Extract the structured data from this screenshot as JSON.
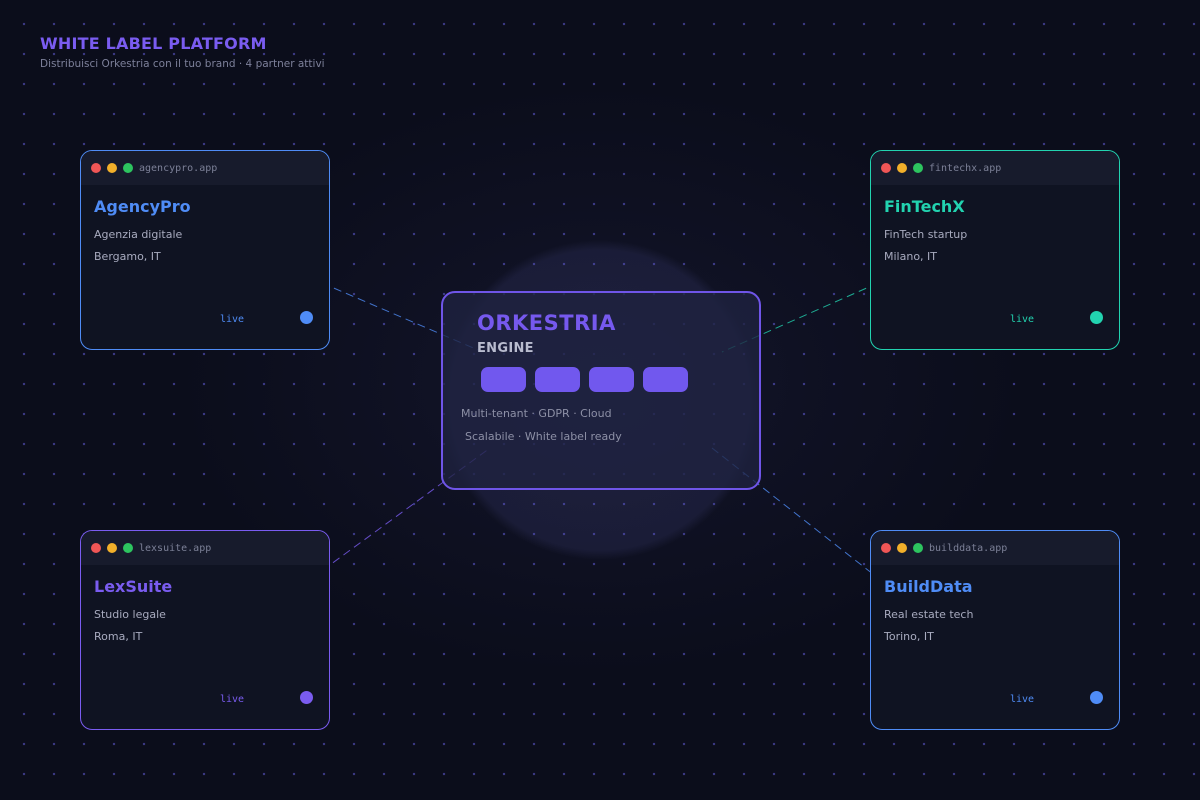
{
  "header": {
    "title": "WHITE LABEL PLATFORM",
    "subtitle": "Distribuisci Orkestria con il tuo brand · 4 partner attivi"
  },
  "engine": {
    "title": "ORKESTRIA",
    "subtitle": "ENGINE",
    "features_line1": "Multi-tenant · GDPR · Cloud",
    "features_line2": "Scalabile · White label ready",
    "color": "#7659ee"
  },
  "partners": [
    {
      "domain": "agencypro.app",
      "name": "AgencyPro",
      "description": "Agenzia digitale",
      "location": "Bergamo, IT",
      "status": "live",
      "color": "#4f8cf6"
    },
    {
      "domain": "fintechx.app",
      "name": "FinTechX",
      "description": "FinTech startup",
      "location": "Milano, IT",
      "status": "live",
      "color": "#22d3b0"
    },
    {
      "domain": "lexsuite.app",
      "name": "LexSuite",
      "description": "Studio legale",
      "location": "Roma, IT",
      "status": "live",
      "color": "#7a5cf0"
    },
    {
      "domain": "builddata.app",
      "name": "BuildData",
      "description": "Real estate tech",
      "location": "Torino, IT",
      "status": "live",
      "color": "#4f8cf6"
    }
  ],
  "window_controls": {
    "close": "#ef5656",
    "minimize": "#f2b02a",
    "maximize": "#2dc45f"
  }
}
